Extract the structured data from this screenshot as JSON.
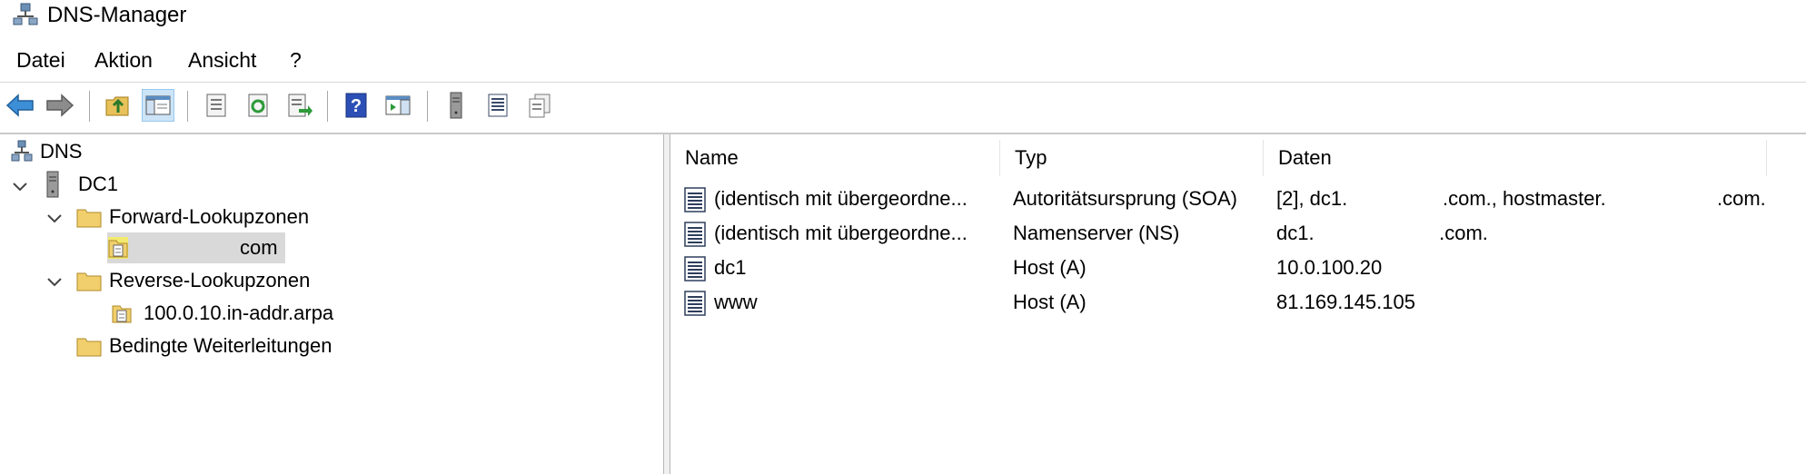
{
  "window": {
    "title": "DNS-Manager"
  },
  "menu": {
    "items": [
      "Datei",
      "Aktion",
      "Ansicht",
      "?"
    ]
  },
  "toolbar": {
    "buttons": [
      "back-arrow-icon",
      "forward-arrow-icon",
      "up-folder-icon",
      "show-hide-tree-icon",
      "properties-icon",
      "refresh-icon",
      "export-list-icon",
      "help-icon",
      "action-pane-icon",
      "server-icon",
      "record-list-icon",
      "copy-records-icon"
    ]
  },
  "tree": {
    "root": "DNS",
    "server": "DC1",
    "forward_zones": "Forward-Lookupzonen",
    "forward_zone_child": "com",
    "reverse_zones": "Reverse-Lookupzonen",
    "reverse_zone_child": "100.0.10.in-addr.arpa",
    "conditional_forwarders": "Bedingte Weiterleitungen"
  },
  "list": {
    "columns": [
      "Name",
      "Typ",
      "Daten"
    ],
    "rows": [
      {
        "name": "(identisch mit übergeordne...",
        "type": "Autoritätsursprung (SOA)",
        "data_a": "[2], dc1.",
        "data_b": ".com., hostmaster.",
        "data_c": ".com."
      },
      {
        "name": "(identisch mit übergeordne...",
        "type": "Namenserver (NS)",
        "data_a": "dc1.",
        "data_b": " .com.",
        "data_c": ""
      },
      {
        "name": "dc1",
        "type": "Host (A)",
        "data_a": "10.0.100.20",
        "data_b": "",
        "data_c": ""
      },
      {
        "name": "www",
        "type": "Host (A)",
        "data_a": "81.169.145.105",
        "data_b": "",
        "data_c": ""
      }
    ]
  }
}
